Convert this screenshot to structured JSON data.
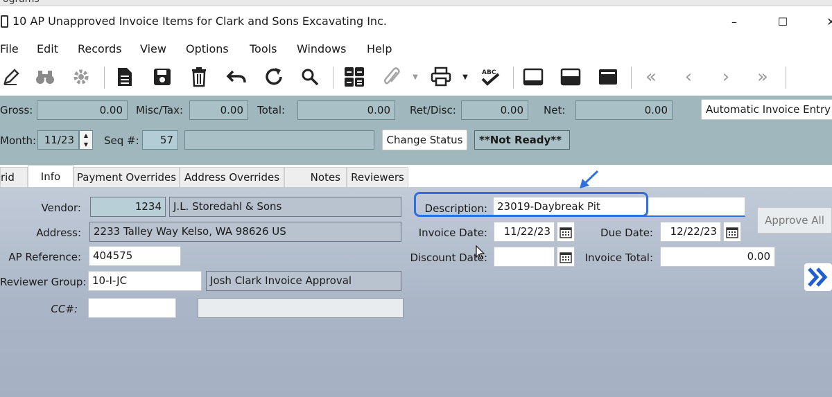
{
  "behind_window": {
    "text": "ograms"
  },
  "window": {
    "title": "10 AP Unapproved Invoice Items for Clark and Sons Excavating Inc.",
    "minimize_glyph": "–",
    "maximize_glyph": "☐",
    "close_glyph": "✕"
  },
  "menu": [
    "File",
    "Edit",
    "Records",
    "View",
    "Options",
    "Tools",
    "Windows",
    "Help"
  ],
  "toolbar": {
    "icons": [
      "edit-icon",
      "binoculars-icon",
      "settings-gear-icon",
      "new-document-icon",
      "save-icon",
      "delete-trash-icon",
      "undo-icon",
      "refresh-icon",
      "search-icon",
      "calculator-icon",
      "attachment-paperclip-icon",
      "print-icon",
      "spellcheck-icon",
      "layout-top-icon",
      "layout-middle-icon",
      "layout-bottom-icon",
      "first-record-icon",
      "previous-record-icon",
      "next-record-icon",
      "last-record-icon"
    ]
  },
  "header": {
    "gross_label": "Gross:",
    "gross_value": "0.00",
    "misc_tax_label": "Misc/Tax:",
    "misc_tax_value": "0.00",
    "total_label": "Total:",
    "total_value": "0.00",
    "ret_disc_label": "Ret/Disc:",
    "ret_disc_value": "0.00",
    "net_label": "Net:",
    "net_value": "0.00",
    "auto_invoice_button": "Automatic Invoice Entry",
    "month_label": "Month:",
    "month_value": "11/23",
    "seq_label": "Seq #:",
    "seq_value": "57",
    "seq_desc_value": "",
    "change_status_button": "Change Status",
    "status_value": "**Not Ready**"
  },
  "tabs": [
    "rid",
    "Info",
    "Payment Overrides",
    "Address Overrides",
    "Notes",
    "Reviewers"
  ],
  "active_tab": "Info",
  "info": {
    "vendor_label": "Vendor:",
    "vendor_id": "1234",
    "vendor_name": "J.L. Storedahl & Sons",
    "address_label": "Address:",
    "address_value": "2233 Talley Way  Kelso, WA  98626  US",
    "ap_reference_label": "AP Reference:",
    "ap_reference_value": "404575",
    "reviewer_group_label": "Reviewer Group:",
    "reviewer_group_value": "10-I-JC",
    "reviewer_group_desc": "Josh Clark Invoice Approval",
    "cc_label": "CC#:",
    "cc_value": "",
    "cc_desc": "",
    "description_label": "Description:",
    "description_value": "23019-Daybreak Pit",
    "invoice_date_label": "Invoice Date:",
    "invoice_date_value": "11/22/23",
    "due_date_label": "Due Date:",
    "due_date_value": "12/22/23",
    "discount_date_label": "Discount Date:",
    "discount_date_value": "",
    "invoice_total_label": "Invoice Total:",
    "invoice_total_value": "0.00",
    "approve_all_button": "Approve All"
  },
  "colors": {
    "header_bg": "#9fb7bd",
    "body_bg": "#aab6c7",
    "highlight": "#2f6fe0"
  }
}
